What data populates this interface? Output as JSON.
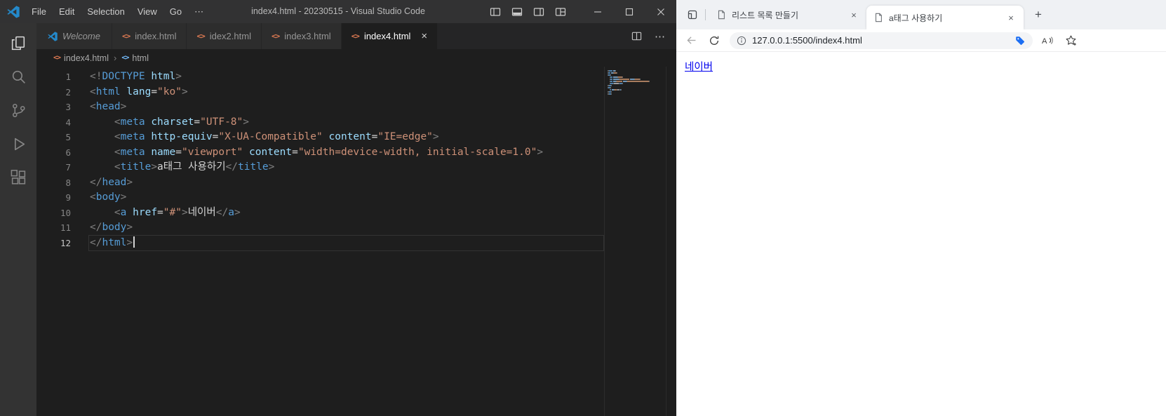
{
  "vscode": {
    "titlebar": {
      "menus": [
        "File",
        "Edit",
        "Selection",
        "View",
        "Go",
        "⋯"
      ],
      "title": "index4.html - 20230515 - Visual Studio Code"
    },
    "editor_tabs": [
      {
        "label": "Welcome",
        "kind": "welcome",
        "active": false
      },
      {
        "label": "index.html",
        "kind": "html",
        "active": false
      },
      {
        "label": "idex2.html",
        "kind": "html",
        "active": false
      },
      {
        "label": "index3.html",
        "kind": "html",
        "active": false
      },
      {
        "label": "index4.html",
        "kind": "html",
        "active": true
      }
    ],
    "breadcrumb": {
      "file": "index4.html",
      "separator": "›",
      "symbol": "html"
    },
    "code": {
      "active_line": 12,
      "lines": [
        {
          "n": 1,
          "tokens": [
            [
              "p",
              "<!"
            ],
            [
              "t",
              "DOCTYPE"
            ],
            [
              "x",
              " "
            ],
            [
              "a",
              "html"
            ],
            [
              "p",
              ">"
            ]
          ]
        },
        {
          "n": 2,
          "tokens": [
            [
              "p",
              "<"
            ],
            [
              "t",
              "html"
            ],
            [
              "x",
              " "
            ],
            [
              "a",
              "lang"
            ],
            [
              "e",
              "="
            ],
            [
              "s",
              "\"ko\""
            ],
            [
              "p",
              ">"
            ]
          ]
        },
        {
          "n": 3,
          "tokens": [
            [
              "p",
              "<"
            ],
            [
              "t",
              "head"
            ],
            [
              "p",
              ">"
            ]
          ]
        },
        {
          "n": 4,
          "tokens": [
            [
              "x",
              "    "
            ],
            [
              "p",
              "<"
            ],
            [
              "t",
              "meta"
            ],
            [
              "x",
              " "
            ],
            [
              "a",
              "charset"
            ],
            [
              "e",
              "="
            ],
            [
              "s",
              "\"UTF-8\""
            ],
            [
              "p",
              ">"
            ]
          ]
        },
        {
          "n": 5,
          "tokens": [
            [
              "x",
              "    "
            ],
            [
              "p",
              "<"
            ],
            [
              "t",
              "meta"
            ],
            [
              "x",
              " "
            ],
            [
              "a",
              "http-equiv"
            ],
            [
              "e",
              "="
            ],
            [
              "s",
              "\"X-UA-Compatible\""
            ],
            [
              "x",
              " "
            ],
            [
              "a",
              "content"
            ],
            [
              "e",
              "="
            ],
            [
              "s",
              "\"IE=edge\""
            ],
            [
              "p",
              ">"
            ]
          ]
        },
        {
          "n": 6,
          "tokens": [
            [
              "x",
              "    "
            ],
            [
              "p",
              "<"
            ],
            [
              "t",
              "meta"
            ],
            [
              "x",
              " "
            ],
            [
              "a",
              "name"
            ],
            [
              "e",
              "="
            ],
            [
              "s",
              "\"viewport\""
            ],
            [
              "x",
              " "
            ],
            [
              "a",
              "content"
            ],
            [
              "e",
              "="
            ],
            [
              "s",
              "\"width=device-width, initial-scale=1.0\""
            ],
            [
              "p",
              ">"
            ]
          ]
        },
        {
          "n": 7,
          "tokens": [
            [
              "x",
              "    "
            ],
            [
              "p",
              "<"
            ],
            [
              "t",
              "title"
            ],
            [
              "p",
              ">"
            ],
            [
              "x",
              "a태그 사용하기"
            ],
            [
              "p",
              "</"
            ],
            [
              "t",
              "title"
            ],
            [
              "p",
              ">"
            ]
          ]
        },
        {
          "n": 8,
          "tokens": [
            [
              "p",
              "</"
            ],
            [
              "t",
              "head"
            ],
            [
              "p",
              ">"
            ]
          ]
        },
        {
          "n": 9,
          "tokens": [
            [
              "p",
              "<"
            ],
            [
              "t",
              "body"
            ],
            [
              "p",
              ">"
            ]
          ]
        },
        {
          "n": 10,
          "tokens": [
            [
              "x",
              "    "
            ],
            [
              "p",
              "<"
            ],
            [
              "t",
              "a"
            ],
            [
              "x",
              " "
            ],
            [
              "a",
              "href"
            ],
            [
              "e",
              "="
            ],
            [
              "s",
              "\"#\""
            ],
            [
              "p",
              ">"
            ],
            [
              "x",
              "네이버"
            ],
            [
              "p",
              "</"
            ],
            [
              "t",
              "a"
            ],
            [
              "p",
              ">"
            ]
          ]
        },
        {
          "n": 11,
          "tokens": [
            [
              "p",
              "</"
            ],
            [
              "t",
              "body"
            ],
            [
              "p",
              ">"
            ]
          ]
        },
        {
          "n": 12,
          "tokens": [
            [
              "p",
              "</"
            ],
            [
              "t",
              "html"
            ],
            [
              "p",
              ">"
            ],
            [
              "cur",
              ""
            ]
          ]
        }
      ]
    }
  },
  "browser": {
    "tabs": [
      {
        "label": "리스트 목록 만들기",
        "active": false
      },
      {
        "label": "a태그 사용하기",
        "active": true
      }
    ],
    "url": "127.0.0.1:5500/index4.html",
    "content": {
      "link_text": "네이버"
    }
  },
  "icons": {
    "html_file": "<>",
    "breadcrumb_symbol": "<>",
    "more": "⋯",
    "tab_close": "×",
    "new_tab": "+"
  },
  "colors": {
    "syntax_tag": "#569cd6",
    "syntax_attr": "#9cdcfe",
    "syntax_string": "#ce9178",
    "syntax_punct": "#808080",
    "syntax_text": "#d4d4d4",
    "link_blue": "#0000ee",
    "shopping_tag_blue": "#1c6ef3"
  }
}
